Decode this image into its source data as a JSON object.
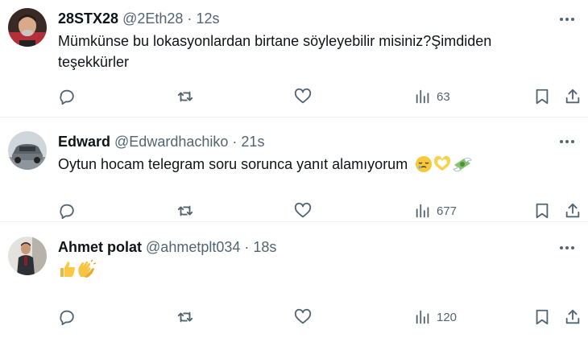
{
  "tweets": [
    {
      "display_name": "28STX28",
      "handle": "@2Eth28",
      "separator": "·",
      "time": "12s",
      "text_line1": "Mümkünse bu lokasyonlardan birtane söyleyebilir misiniz?Şimdiden",
      "text_line2": "teşekkürler",
      "views": "63",
      "avatar_icon": "avatar-photo-man",
      "bookmark_icon": "bookmark-icon"
    },
    {
      "display_name": "Edward",
      "handle": "@Edwardhachiko",
      "separator": "·",
      "time": "21s",
      "text_line1": "Oytun hocam telegram soru sorunca yanıt alamıyorum",
      "emojis": [
        "sleepy-face-emoji",
        "heart-hands-emoji",
        "money-with-wings-emoji"
      ],
      "views": "677",
      "avatar_icon": "avatar-photo-car"
    },
    {
      "display_name": "Ahmet polat",
      "handle": "@ahmetplt034",
      "separator": "·",
      "time": "18s",
      "emojis": [
        "thumbs-up-emoji",
        "clapping-hands-emoji"
      ],
      "views": "120",
      "avatar_icon": "avatar-photo-person"
    }
  ],
  "icons": [
    "reply-icon",
    "retweet-icon",
    "like-icon",
    "views-icon",
    "bookmark-icon",
    "share-icon",
    "more-icon"
  ],
  "colors": {
    "text": "#0f1419",
    "secondary": "#536471",
    "divider": "#eff3f4"
  }
}
